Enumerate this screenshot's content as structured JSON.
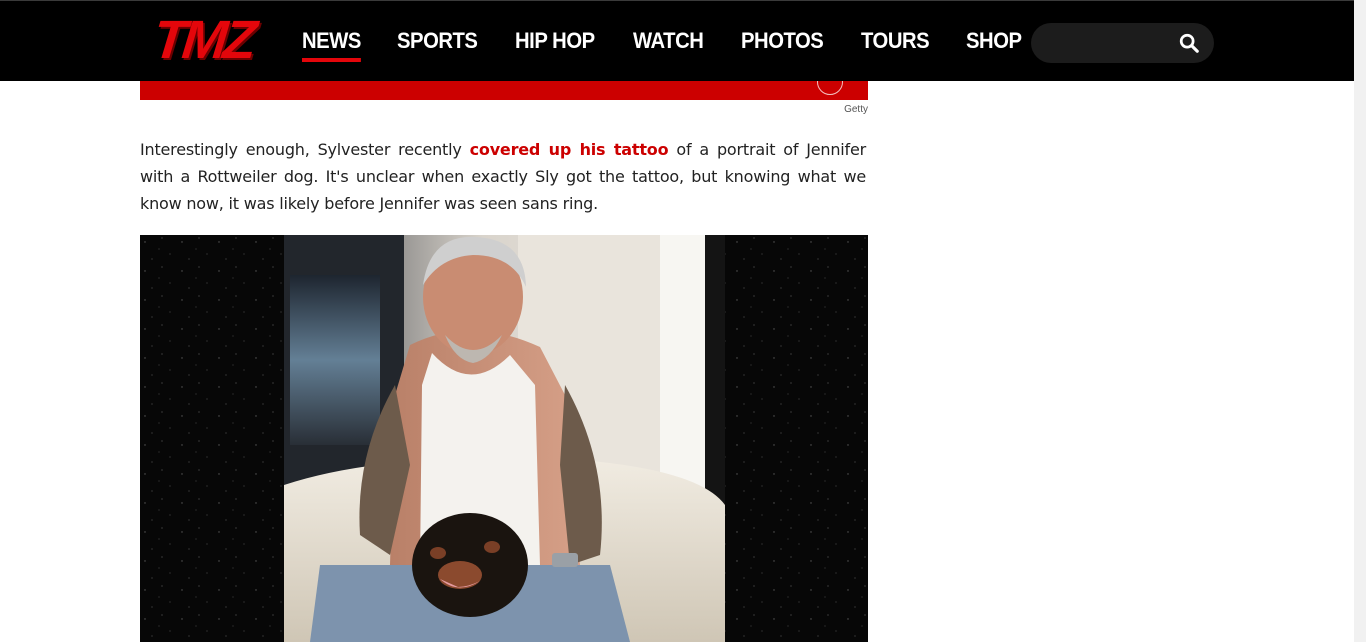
{
  "header": {
    "logo_text": "TMZ",
    "nav": [
      {
        "label": "NEWS",
        "active": true
      },
      {
        "label": "SPORTS",
        "active": false
      },
      {
        "label": "HIP HOP",
        "active": false
      },
      {
        "label": "WATCH",
        "active": false
      },
      {
        "label": "PHOTOS",
        "active": false
      },
      {
        "label": "TOURS",
        "active": false
      },
      {
        "label": "SHOP",
        "active": false
      }
    ],
    "search": {
      "placeholder": "",
      "icon": "search-icon"
    }
  },
  "article": {
    "photo_credit": "Getty",
    "paragraph": {
      "before_link": "Interestingly enough, Sylvester recently ",
      "link_text": "covered up his tattoo",
      "after_link": " of a portrait of Jennifer with a Rottweiler dog. It's unclear when exactly Sly got the tattoo, but knowing what we know now, it was likely before Jennifer was seen sans ring."
    }
  },
  "colors": {
    "brand_red": "#e4060b",
    "link_red": "#cc0000",
    "header_bg": "#000000"
  }
}
